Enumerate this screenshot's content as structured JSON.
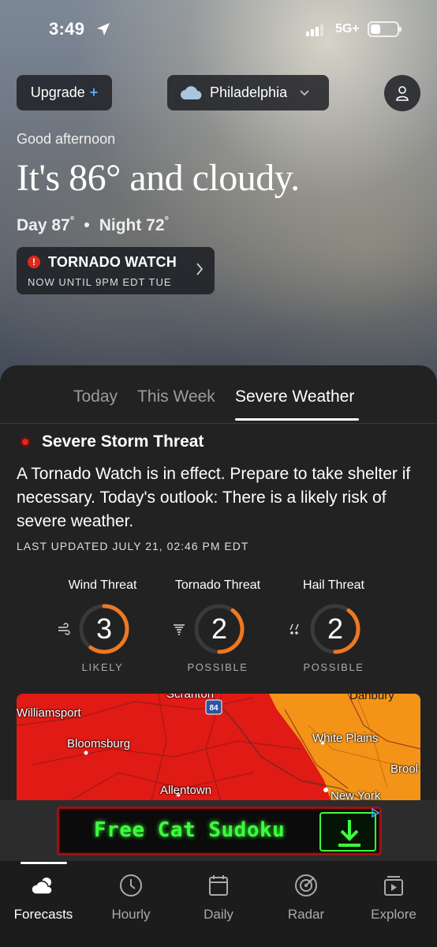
{
  "status_bar": {
    "time": "3:49",
    "network": "5G+"
  },
  "header": {
    "upgrade_label": "Upgrade",
    "upgrade_plus": "+",
    "city": "Philadelphia"
  },
  "current": {
    "greeting": "Good afternoon",
    "headline": "It's 86° and cloudy.",
    "day": "Day 87",
    "night": "Night 72",
    "deg_mark": "°",
    "separator": "•"
  },
  "alert": {
    "title": "TORNADO WATCH",
    "subtitle": "NOW UNTIL 9PM EDT TUE",
    "icon_glyph": "!"
  },
  "tabs": [
    {
      "label": "Today",
      "active": false
    },
    {
      "label": "This Week",
      "active": false
    },
    {
      "label": "Severe Weather",
      "active": true
    }
  ],
  "severe": {
    "title": "Severe Storm Threat",
    "text": "A Tornado Watch is in effect. Prepare to take shelter if necessary. Today's outlook: There is a likely risk of severe weather.",
    "updated": "LAST UPDATED JULY 21, 02:46 PM EDT"
  },
  "threats": [
    {
      "label": "Wind Threat",
      "value": "3",
      "level": "LIKELY",
      "fill": 0.6,
      "icon": "wind-icon"
    },
    {
      "label": "Tornado Threat",
      "value": "2",
      "level": "POSSIBLE",
      "fill": 0.4,
      "icon": "tornado-icon"
    },
    {
      "label": "Hail Threat",
      "value": "2",
      "level": "POSSIBLE",
      "fill": 0.4,
      "icon": "hail-icon"
    }
  ],
  "map": {
    "cities": [
      "Scranton",
      "Danbury",
      "Williamsport",
      "Bloomsburg",
      "White Plains",
      "Brool",
      "Allentown",
      "New York"
    ],
    "highway": "84"
  },
  "ad": {
    "text": "Free Cat Sudoku"
  },
  "nav": [
    {
      "label": "Forecasts",
      "active": true
    },
    {
      "label": "Hourly",
      "active": false
    },
    {
      "label": "Daily",
      "active": false
    },
    {
      "label": "Radar",
      "active": false
    },
    {
      "label": "Explore",
      "active": false
    }
  ],
  "colors": {
    "accent_orange": "#f07820",
    "alert_red": "#e0281f",
    "map_red": "#e01a14",
    "map_orange": "#f39419",
    "ad_green": "#3cff3c"
  }
}
